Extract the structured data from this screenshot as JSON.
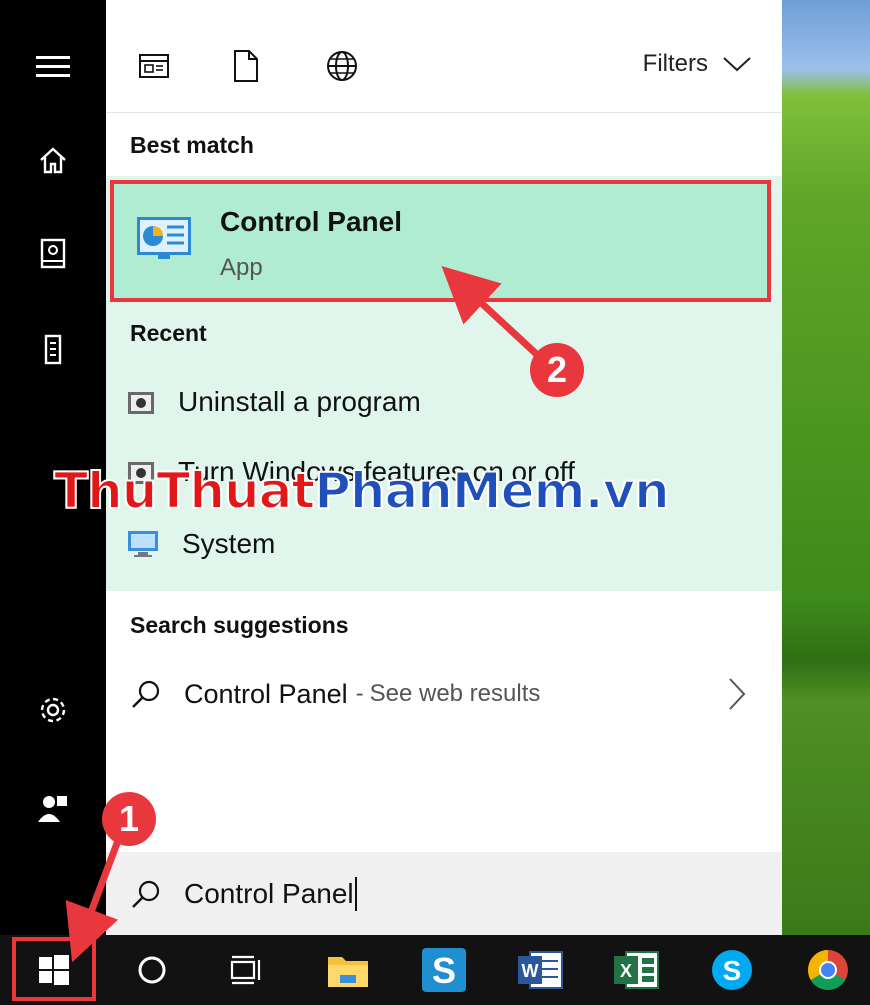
{
  "colors": {
    "accent_red": "#e8383d",
    "best_match_bg": "#b0ecd1",
    "results_bg": "#e0f6ed",
    "taskbar": "#121212"
  },
  "rail": {
    "items": [
      {
        "icon": "hamburger-menu-icon"
      },
      {
        "icon": "home-icon"
      },
      {
        "icon": "documents-icon"
      },
      {
        "icon": "device-icon"
      },
      {
        "icon": "settings-gear-icon"
      },
      {
        "icon": "user-icon"
      }
    ]
  },
  "topbar": {
    "icons": [
      "apps-filter-icon",
      "documents-filter-icon",
      "web-filter-icon"
    ],
    "filters_label": "Filters"
  },
  "best_match": {
    "section_title": "Best match",
    "title": "Control Panel",
    "subtitle": "App",
    "icon": "control-panel-icon"
  },
  "recent": {
    "section_title": "Recent",
    "items": [
      {
        "label": "Uninstall a program",
        "icon": "control-panel-small-icon"
      },
      {
        "label": "Turn Windows features on or off",
        "icon": "control-panel-small-icon"
      },
      {
        "label": "System",
        "icon": "monitor-icon"
      }
    ]
  },
  "suggestions": {
    "section_title": "Search suggestions",
    "main": "Control Panel",
    "separator": "-",
    "web": "See web results"
  },
  "search": {
    "value": "Control Panel"
  },
  "taskbar": {
    "items": [
      "start-icon",
      "cortana-icon",
      "task-view-icon",
      "file-explorer-icon",
      "sway-icon",
      "word-icon",
      "excel-icon",
      "skype-icon",
      "chrome-icon"
    ]
  },
  "annotations": {
    "badge1": "1",
    "badge2": "2"
  },
  "watermark": {
    "part1": "ThuThuat",
    "part2": "PhanMem.vn"
  }
}
